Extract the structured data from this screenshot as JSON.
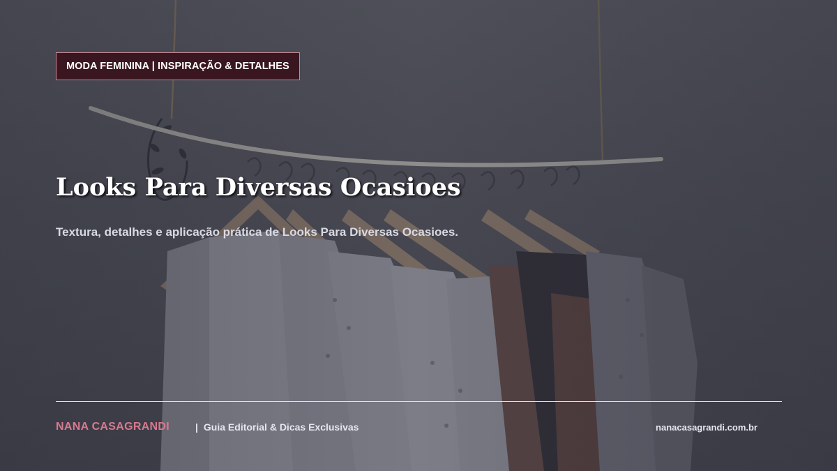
{
  "badge": {
    "label": "MODA FEMININA | INSPIRAÇÃO & DETALHES"
  },
  "article": {
    "title": "Looks Para Diversas Ocasioes",
    "subtitle": "Textura, detalhes e aplicação prática de Looks Para Diversas Ocasioes."
  },
  "footer": {
    "brand": "NANA CASAGRANDI",
    "separator": "|",
    "tagline": "Guia Editorial & Dicas Exclusivas",
    "url": "nanacasagrandi.com.br"
  },
  "colors": {
    "badge_background": "#3a1620",
    "badge_border": "#c98a96",
    "brand_accent": "#d77a8e",
    "title_text": "#ffffff"
  }
}
